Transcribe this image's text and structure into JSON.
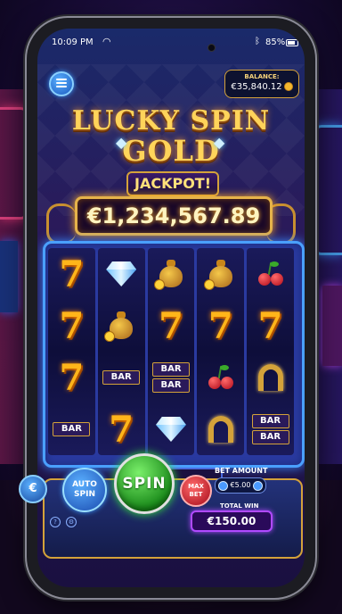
{
  "status_bar": {
    "time": "10:09 PM",
    "battery": "85%"
  },
  "balance": {
    "label": "BALANCE:",
    "value": "€35,840.12"
  },
  "title": {
    "line1": "LUCKY SPIN",
    "line2": "GOLD"
  },
  "jackpot": {
    "label": "JACKPOT!",
    "value": "€1,234,567.89"
  },
  "reels": [
    [
      "seven",
      "seven",
      "seven",
      "bar"
    ],
    [
      "diamond",
      "moneybag",
      "bar",
      "seven"
    ],
    [
      "moneybag",
      "seven",
      "bar2",
      "diamond"
    ],
    [
      "moneybag",
      "seven",
      "cherry",
      "horseshoe"
    ],
    [
      "cherry",
      "seven",
      "horseshoe",
      "bar2"
    ]
  ],
  "symbols": {
    "seven": "7",
    "bar": "BAR"
  },
  "controls": {
    "info_icon": "€",
    "auto_spin": "AUTO\nSPIN",
    "spin": "SPIN",
    "max_bet": "MAX\nBET",
    "max_bet_shown": "MAX BET",
    "bet_amount_label": "BET AMOUNT",
    "bet_amount": "€5.00",
    "total_win_label": "TOTAL WIN",
    "total_win": "€150.00"
  },
  "colors": {
    "gold": "#d4a23a",
    "spin_green": "#1a8a1a",
    "frame_blue": "#4aa0ff"
  }
}
